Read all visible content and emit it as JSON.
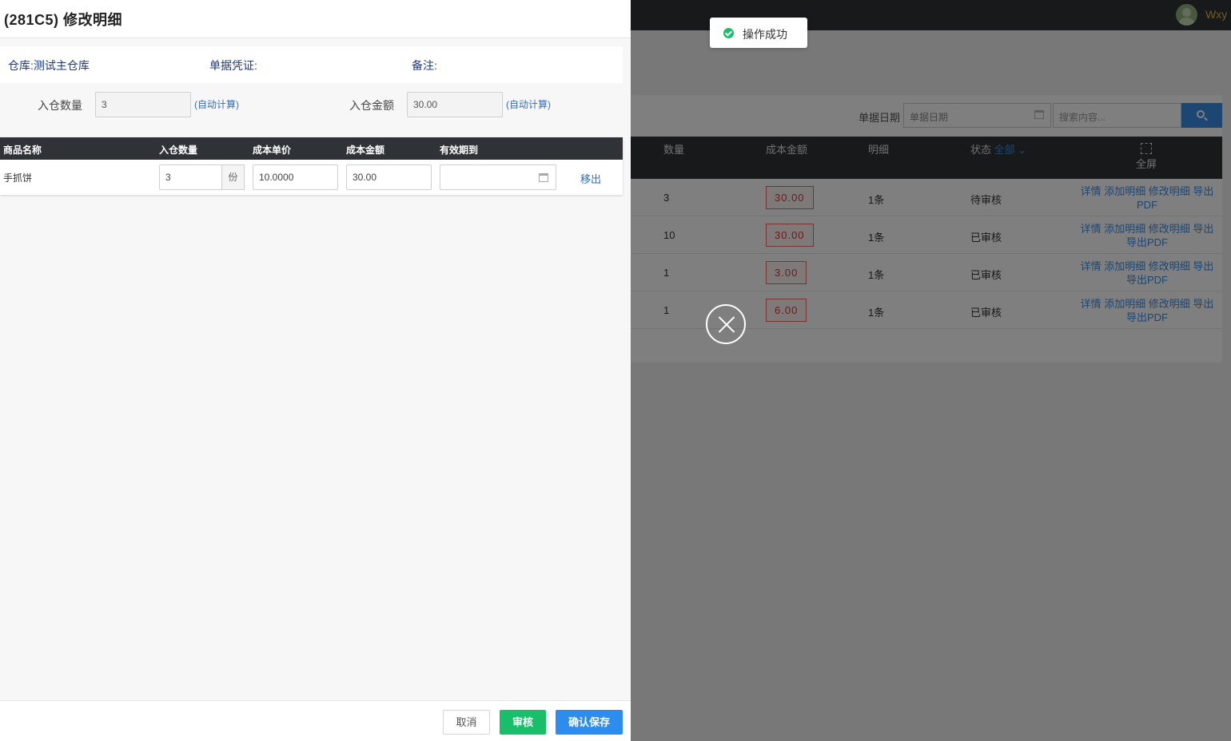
{
  "background": {
    "user_name": "Wxy",
    "search": {
      "date_label": "单据日期",
      "date_placeholder": "单据日期",
      "search_placeholder": "搜索内容..."
    },
    "table": {
      "columns": [
        "数量",
        "成本金额",
        "明细",
        "状态"
      ],
      "status_filter": "全部",
      "fullscreen_label": "全屏",
      "rows": [
        {
          "qty": "3",
          "amount": "30.00",
          "detail": "1条",
          "status": "待审核",
          "actions": "详情 添加明细 修改明细 导出PDF"
        },
        {
          "qty": "10",
          "amount": "30.00",
          "detail": "1条",
          "status": "已审核",
          "actions": "详情 添加明细 修改明细 导出 导出PDF"
        },
        {
          "qty": "1",
          "amount": "3.00",
          "detail": "1条",
          "status": "已审核",
          "actions": "详情 添加明细 修改明细 导出 导出PDF"
        },
        {
          "qty": "1",
          "amount": "6.00",
          "detail": "1条",
          "status": "已审核",
          "actions": "详情 添加明细 修改明细 导出 导出PDF"
        }
      ]
    }
  },
  "toast": {
    "text": "操作成功"
  },
  "drawer": {
    "title": "(281C5) 修改明细",
    "info": {
      "warehouse": "仓库:测试主仓库",
      "voucher": "单据凭证:",
      "remark": "备注:"
    },
    "summary": {
      "qty_label": "入仓数量",
      "qty_value": "3",
      "amount_label": "入仓金额",
      "amount_value": "30.00",
      "auto_calc": "(自动计算)"
    },
    "detail_table": {
      "headers": [
        "商品名称",
        "入仓数量",
        "成本单价",
        "成本金额",
        "有效期到"
      ],
      "row": {
        "product": "手抓饼",
        "qty": "3",
        "unit": "份",
        "unit_price": "10.0000",
        "cost_amount": "30.00",
        "expiry": "",
        "remove": "移出"
      }
    },
    "footer": {
      "cancel": "取消",
      "audit": "审核",
      "save": "确认保存"
    }
  }
}
